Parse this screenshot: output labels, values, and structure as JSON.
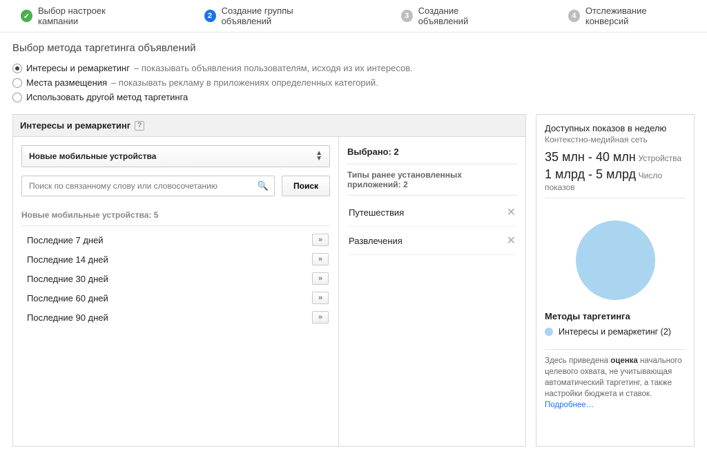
{
  "steps": {
    "s1": "Выбор настроек кампании",
    "s2": "Создание группы объявлений",
    "s3": "Создание объявлений",
    "s4": "Отслеживание конверсий"
  },
  "section_title": "Выбор метода таргетинга объявлений",
  "radios": {
    "r1_label": "Интересы и ремаркетинг",
    "r1_desc": " – показывать объявления пользователям, исходя из их интересов.",
    "r2_label": "Места размещения",
    "r2_desc": " – показывать рекламу в приложениях определенных категорий.",
    "r3_label": "Использовать другой метод таргетинга"
  },
  "panel": {
    "title": "Интересы и ремаркетинг",
    "help": "?",
    "dropdown": "Новые мобильные устройства",
    "search_placeholder": "Поиск по связанному слову или словосочетанию",
    "search_btn": "Поиск",
    "subhead": "Новые мобильные устройства: 5",
    "items": [
      "Последние 7 дней",
      "Последние 14 дней",
      "Последние 30 дней",
      "Последние 60 дней",
      "Последние 90 дней"
    ],
    "arrow": "»"
  },
  "selected": {
    "title": "Выбрано: 2",
    "subhead": "Типы ранее установленных приложений: 2",
    "items": [
      "Путешествия",
      "Развлечения"
    ]
  },
  "stats": {
    "line1": "Доступных показов в неделю",
    "line2": "Контекстно-медийная сеть",
    "range1": "35 млн - 40 млн",
    "range1_unit": "Устройства",
    "range2": "1 млрд - 5 млрд",
    "range2_unit": "Число показов",
    "legend_title": "Методы таргетинга",
    "legend_item": "Интересы и ремаркетинг (2)",
    "note_pre": "Здесь приведена ",
    "note_bold": "оценка",
    "note_post": " начального целевого охвата, не учитывающая автоматический таргетинг, а также настройки бюджета и ставок.",
    "more": "Подробнее…"
  }
}
